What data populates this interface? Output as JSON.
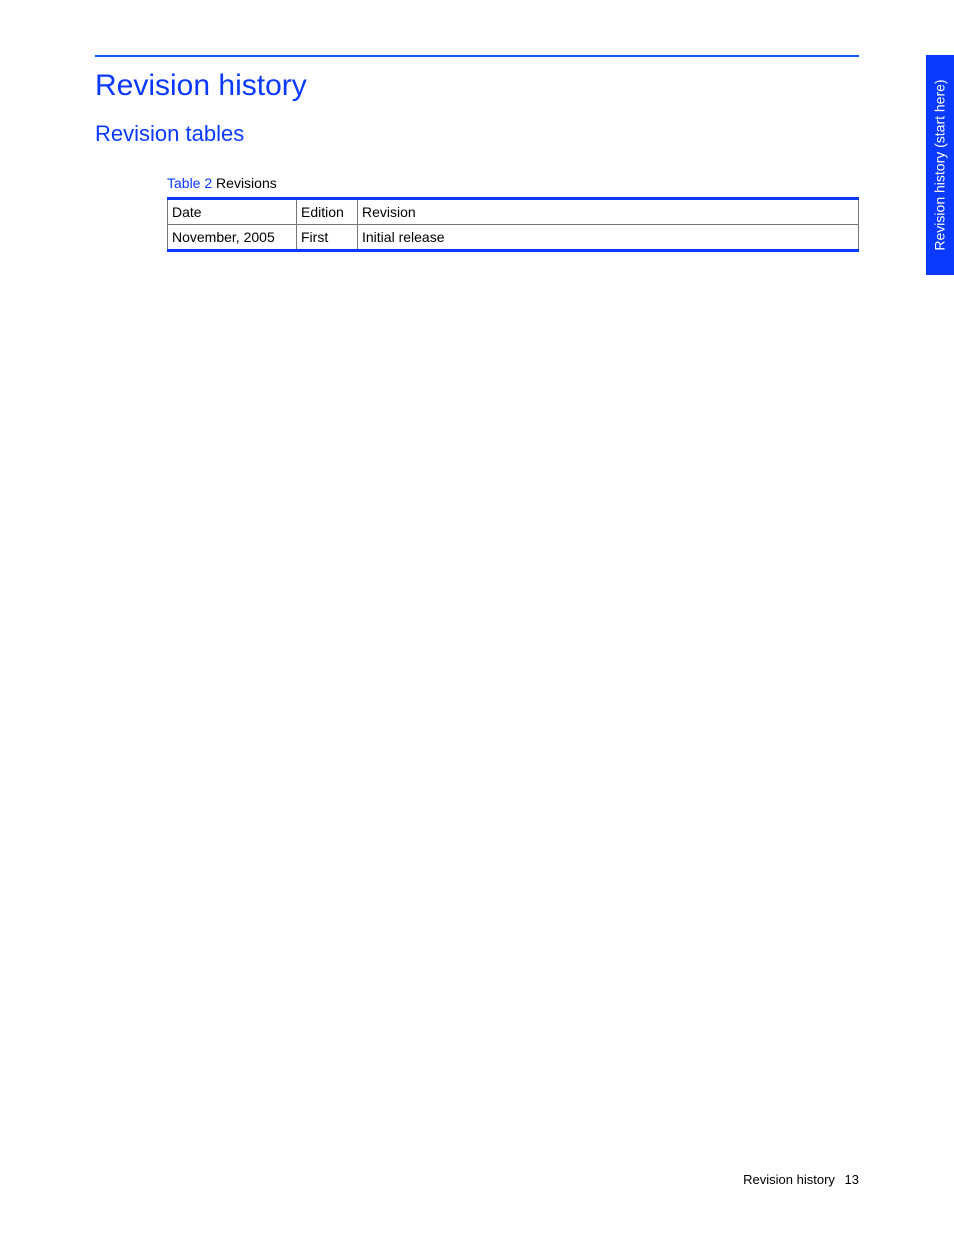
{
  "headings": {
    "h1": "Revision history",
    "h2": "Revision tables"
  },
  "table": {
    "caption_label": "Table 2",
    "caption_name": "Revisions",
    "headers": [
      "Date",
      "Edition",
      "Revision"
    ],
    "rows": [
      {
        "date": "November, 2005",
        "edition": "First",
        "revision": "Initial release"
      }
    ]
  },
  "side_tab": "Revision history (start here)",
  "footer": {
    "section": "Revision history",
    "page": "13"
  }
}
